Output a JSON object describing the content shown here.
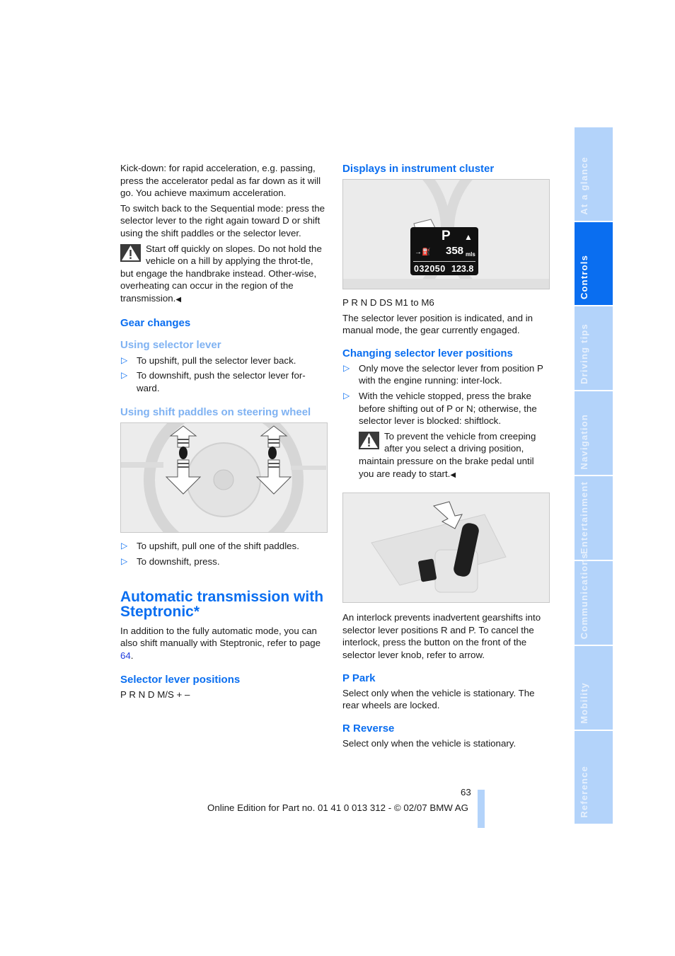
{
  "left_column": {
    "kickdown_text": "Kick-down: for rapid acceleration, e.g. passing, press the accelerator pedal as far down as it will go. You achieve maximum acceleration.",
    "switch_back_text": "To switch back to the Sequential mode: press the selector lever to the right again toward D or shift using the shift paddles or the selector lever.",
    "warning_slopes": "Start off quickly on slopes. Do not hold the vehicle on a hill by applying the throt-tle, but engage the handbrake instead. Other-wise, overheating can occur in the region of the transmission.",
    "gear_changes_heading": "Gear changes",
    "selector_lever_heading": "Using selector lever",
    "selector_lever_items": [
      "To upshift, pull the selector lever back.",
      "To downshift, push the selector lever for-ward."
    ],
    "paddles_heading": "Using shift paddles on steering wheel",
    "paddles_items": [
      "To upshift, pull one of the shift paddles.",
      "To downshift, press."
    ],
    "main_heading": "Automatic transmission with Steptronic*",
    "intro_text": "In addition to the fully automatic mode, you can also shift manually with Steptronic, refer to page ",
    "intro_link": "64",
    "intro_end": ".",
    "selector_positions_heading": "Selector lever positions",
    "selector_positions_text": "P R N D M/S + –"
  },
  "right_column": {
    "displays_heading": "Displays in instrument cluster",
    "cluster": {
      "gear": "P",
      "range": "358",
      "range_unit": "mls",
      "odometer": "032050",
      "trip": "123.8",
      "unit_small": "mls"
    },
    "positions_text": "P R N D DS M1 to M6",
    "indicated_text": "The selector lever position is indicated, and in manual mode, the gear currently engaged.",
    "changing_heading": "Changing selector lever positions",
    "changing_items": [
      "Only move the selector lever from position P with the engine running: inter-lock.",
      "With the vehicle stopped, press the brake before shifting out of P or N; otherwise, the selector lever is blocked: shiftlock."
    ],
    "warning_creeping": "To prevent the vehicle from creeping after you select a driving position, maintain pressure on the brake pedal until you are ready to start.",
    "interlock_text": "An interlock prevents inadvertent gearshifts into selector lever positions R and P. To cancel the interlock, press the button on the front of the selector lever knob, refer to arrow.",
    "park_heading": "P Park",
    "park_text": "Select only when the vehicle is stationary. The rear wheels are locked.",
    "reverse_heading": "R Reverse",
    "reverse_text": "Select only when the vehicle is stationary."
  },
  "end_mark": "◀",
  "bullet_glyph": "▷",
  "side_tabs": [
    {
      "label": "At a glance",
      "active": false
    },
    {
      "label": "Controls",
      "active": true
    },
    {
      "label": "Driving tips",
      "active": false
    },
    {
      "label": "Navigation",
      "active": false
    },
    {
      "label": "Entertainment",
      "active": false
    },
    {
      "label": "Communications",
      "active": false
    },
    {
      "label": "Mobility",
      "active": false
    },
    {
      "label": "Reference",
      "active": false
    }
  ],
  "footer": {
    "page_number": "63",
    "edition_text": "Online Edition for Part no. 01 41 0 013 312 - © 02/07 BMW AG"
  },
  "colors": {
    "heading_blue": "#0a6ef0",
    "subheading_light_blue": "#7fb2f2",
    "tab_inactive": "#b3d3fa",
    "tab_active": "#0a6ef0",
    "link": "#1f3cde"
  }
}
